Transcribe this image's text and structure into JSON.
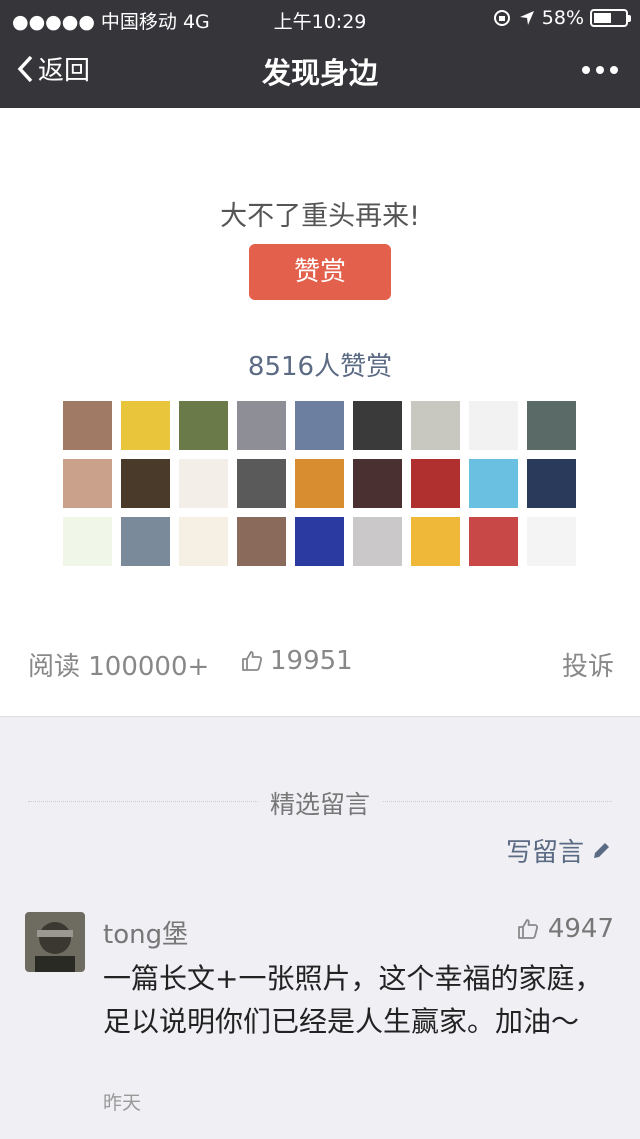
{
  "status_bar": {
    "carrier": "●●●●● 中国移动   4G",
    "time": "上午10:29",
    "battery": "58%",
    "battery_level": 0.58
  },
  "nav": {
    "back_label": "返回",
    "title": "发现身边",
    "more_icon": "more-dots-icon"
  },
  "reward": {
    "message": "大不了重头再来!",
    "button_label": "赞赏",
    "count_text": "8516人赞赏",
    "avatar_colors": [
      "#a07a64",
      "#e8c53a",
      "#6a7a48",
      "#8e8e96",
      "#6d7fa0",
      "#3a3a3a",
      "#c8c8c0",
      "#f2f2f2",
      "#5a6a66",
      "#caa28c",
      "#4a3a2a",
      "#f4eee8",
      "#5a5a5a",
      "#d88e30",
      "#4a3030",
      "#b03030",
      "#6ac0e0",
      "#2a3a5a",
      "#f0f6e8",
      "#7a8a9a",
      "#f6f0e4",
      "#8a6a5a",
      "#2a3aa0",
      "#cac8c8",
      "#f0b838",
      "#c84848",
      "#f4f4f4"
    ]
  },
  "stats": {
    "read": "阅读 100000+",
    "likes": "19951",
    "report": "投诉"
  },
  "comments": {
    "section_title": "精选留言",
    "write_label": "写留言",
    "items": [
      {
        "name": "tong堡",
        "likes": "4947",
        "text": "一篇长文+一张照片，这个幸福的家庭，足以说明你们已经是人生赢家。加油～",
        "time": "昨天"
      }
    ]
  }
}
